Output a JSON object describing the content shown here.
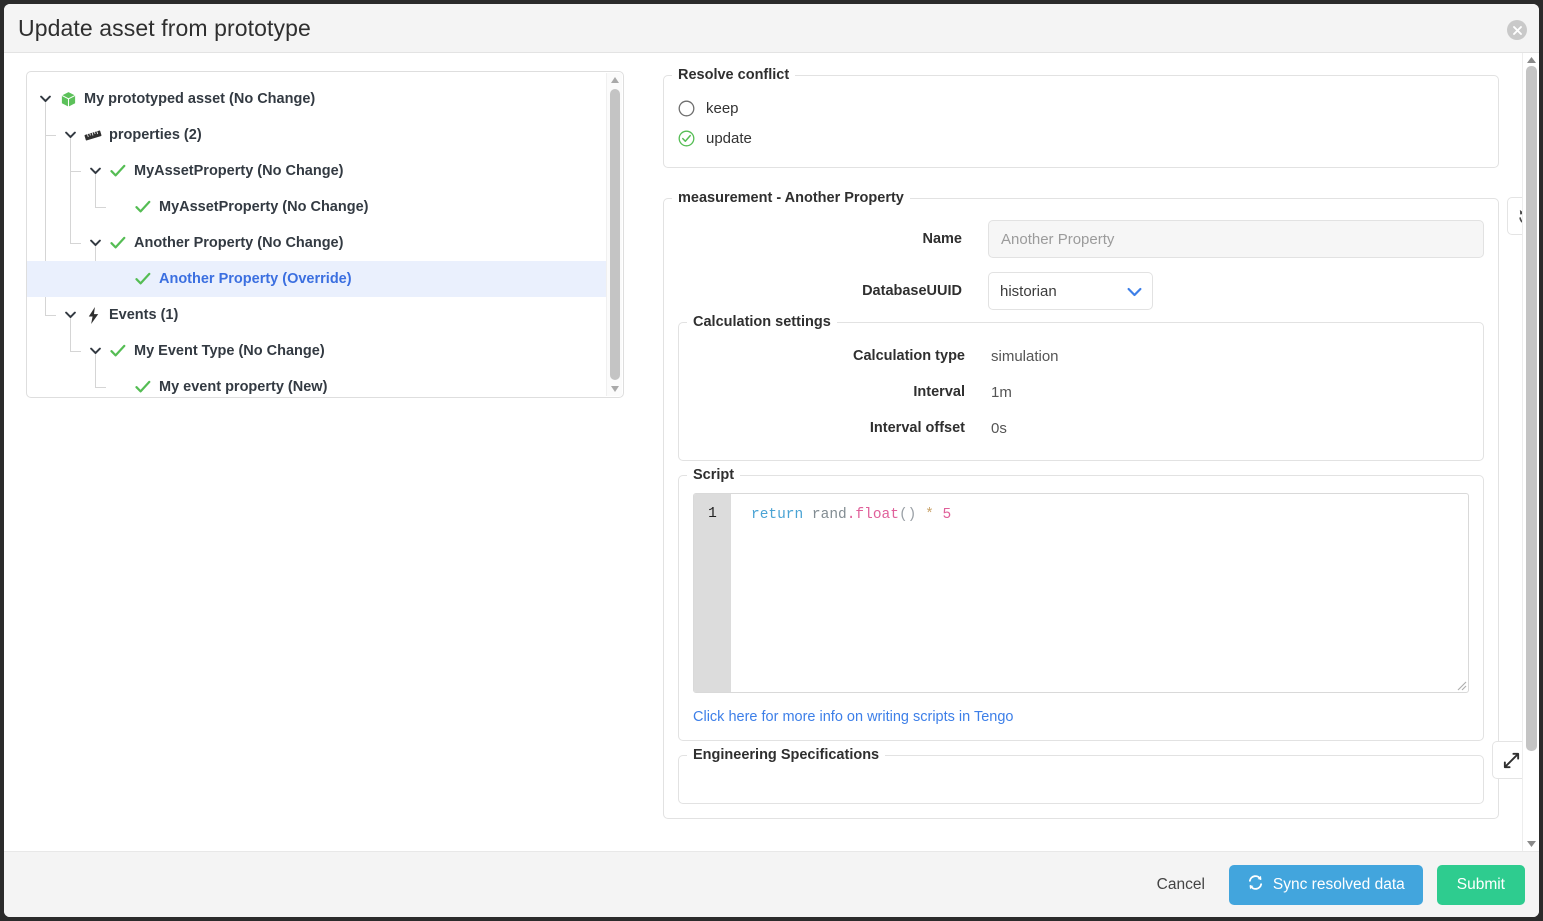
{
  "dialog": {
    "title": "Update asset from prototype",
    "close_icon": "close-icon"
  },
  "tree": {
    "nodes": [
      {
        "label": "My prototyped asset (No Change)",
        "depth": 0,
        "icon": "green-cube-icon",
        "caret": true,
        "selected": false
      },
      {
        "label": "properties (2)",
        "depth": 1,
        "icon": "ruler-icon",
        "caret": true,
        "selected": false
      },
      {
        "label": "MyAssetProperty (No Change)",
        "depth": 2,
        "icon": "green-check-icon",
        "caret": true,
        "selected": false
      },
      {
        "label": "MyAssetProperty (No Change)",
        "depth": 3,
        "icon": "green-check-icon",
        "caret": false,
        "selected": false
      },
      {
        "label": "Another Property (No Change)",
        "depth": 2,
        "icon": "green-check-icon",
        "caret": true,
        "selected": false
      },
      {
        "label": "Another Property (Override)",
        "depth": 3,
        "icon": "green-check-icon",
        "caret": false,
        "selected": true
      },
      {
        "label": "Events (1)",
        "depth": 1,
        "icon": "lightning-bolt-icon",
        "caret": true,
        "selected": false
      },
      {
        "label": "My Event Type (No Change)",
        "depth": 2,
        "icon": "green-check-icon",
        "caret": true,
        "selected": false
      },
      {
        "label": "My event property (New)",
        "depth": 3,
        "icon": "green-check-icon",
        "caret": false,
        "selected": false
      }
    ]
  },
  "resolve_conflict": {
    "legend": "Resolve conflict",
    "options": [
      {
        "label": "keep",
        "selected": false
      },
      {
        "label": "update",
        "selected": true
      }
    ]
  },
  "measurement": {
    "legend": "measurement - Another Property",
    "revert_icon": "revert-icon",
    "name_label": "Name",
    "name_value": "",
    "name_placeholder": "Another Property",
    "database_label": "DatabaseUUID",
    "database_value": "historian",
    "database_options": [
      "historian"
    ]
  },
  "calculation_settings": {
    "legend": "Calculation settings",
    "rows": [
      {
        "label": "Calculation type",
        "value": "simulation"
      },
      {
        "label": "Interval",
        "value": "1m"
      },
      {
        "label": "Interval offset",
        "value": "0s"
      }
    ]
  },
  "script": {
    "legend": "Script",
    "line_number": "1",
    "tokens": {
      "kw": "return",
      "space1": " ",
      "id": "rand",
      "dot_fn": ".float",
      "parens": "()",
      "space2": " ",
      "op": "*",
      "space3": " ",
      "num": "5"
    },
    "plain": "return rand.float() * 5",
    "link_text": "Click here for more info on writing scripts in Tengo"
  },
  "engineering_specifications": {
    "legend": "Engineering Specifications",
    "expand_icon": "expand-icon"
  },
  "footer": {
    "cancel_label": "Cancel",
    "sync_label": "Sync resolved data",
    "sync_icon": "sync-icon",
    "submit_label": "Submit"
  },
  "colors": {
    "accent_blue": "#3d7fe8",
    "sync_blue": "#42a5dd",
    "submit_green": "#2ecc8f",
    "check_green": "#55bd54",
    "selected_row_bg": "#eaf0fd"
  }
}
